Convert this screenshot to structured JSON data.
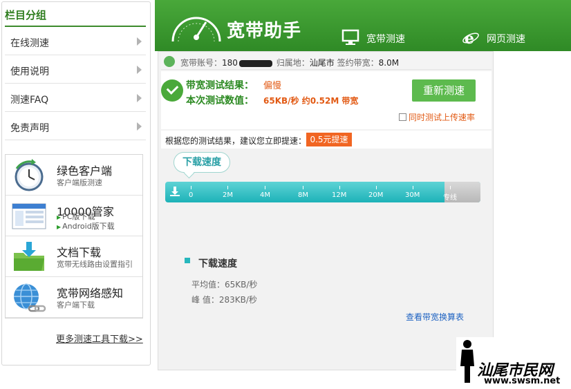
{
  "sidebar": {
    "title": "栏目分组",
    "menu": [
      {
        "label": "在线测速"
      },
      {
        "label": "使用说明"
      },
      {
        "label": "测速FAQ"
      },
      {
        "label": "免责声明"
      }
    ],
    "tools": [
      {
        "name": "绿色客户端",
        "sub": "客户端版测速",
        "icon": "clock-icon"
      },
      {
        "name": "10000管家",
        "sub1": "PC版下载",
        "sub2": "Android版下载",
        "icon": "screenshot-icon"
      },
      {
        "name": "文档下载",
        "sub": "宽带无线路由设置指引",
        "icon": "folder-download-icon"
      },
      {
        "name": "宽带网络感知",
        "sub": "客户端下载",
        "icon": "globe-link-icon"
      }
    ],
    "more_link": "更多测速工具下载>>"
  },
  "header": {
    "title": "宽带助手",
    "tabs": [
      {
        "label": "宽带测速",
        "icon": "monitor-icon"
      },
      {
        "label": "网页测速",
        "icon": "ie-browser-icon"
      }
    ]
  },
  "info": {
    "account_label": "宽带账号：",
    "account_value": "180",
    "region_label": "归属地：",
    "region_value": "汕尾市",
    "bandwidth_label": "签约带宽：",
    "bandwidth_value": "8.0M"
  },
  "result": {
    "label1": "带宽测试结果：",
    "value1": "偏慢",
    "label2": "本次测试数值：",
    "value2": "65KB/秒 约0.52M 带宽",
    "retest_button": "重新测速",
    "upload_checkbox": "同时测试上传速率"
  },
  "suggestion": {
    "text": "根据您的测试结果，建议您立即提速：",
    "button": "0.5元提速"
  },
  "speed": {
    "bubble": "下载速度",
    "ticks": [
      "0",
      "2M",
      "4M",
      "8M",
      "12M",
      "20M",
      "30M",
      "专线"
    ],
    "legend": "下载速度",
    "average": "平均值：65KB/秒",
    "peak": "峰  值：283KB/秒",
    "calc_link": "查看带宽换算表"
  },
  "watermark": {
    "text": "汕尾市民网",
    "url": "www.swsm.net"
  },
  "colors": {
    "header_green": "#3b9a2e",
    "accent_orange": "#e25a14",
    "bar_teal": "#1db2b8",
    "retest_green": "#5dba4e"
  }
}
